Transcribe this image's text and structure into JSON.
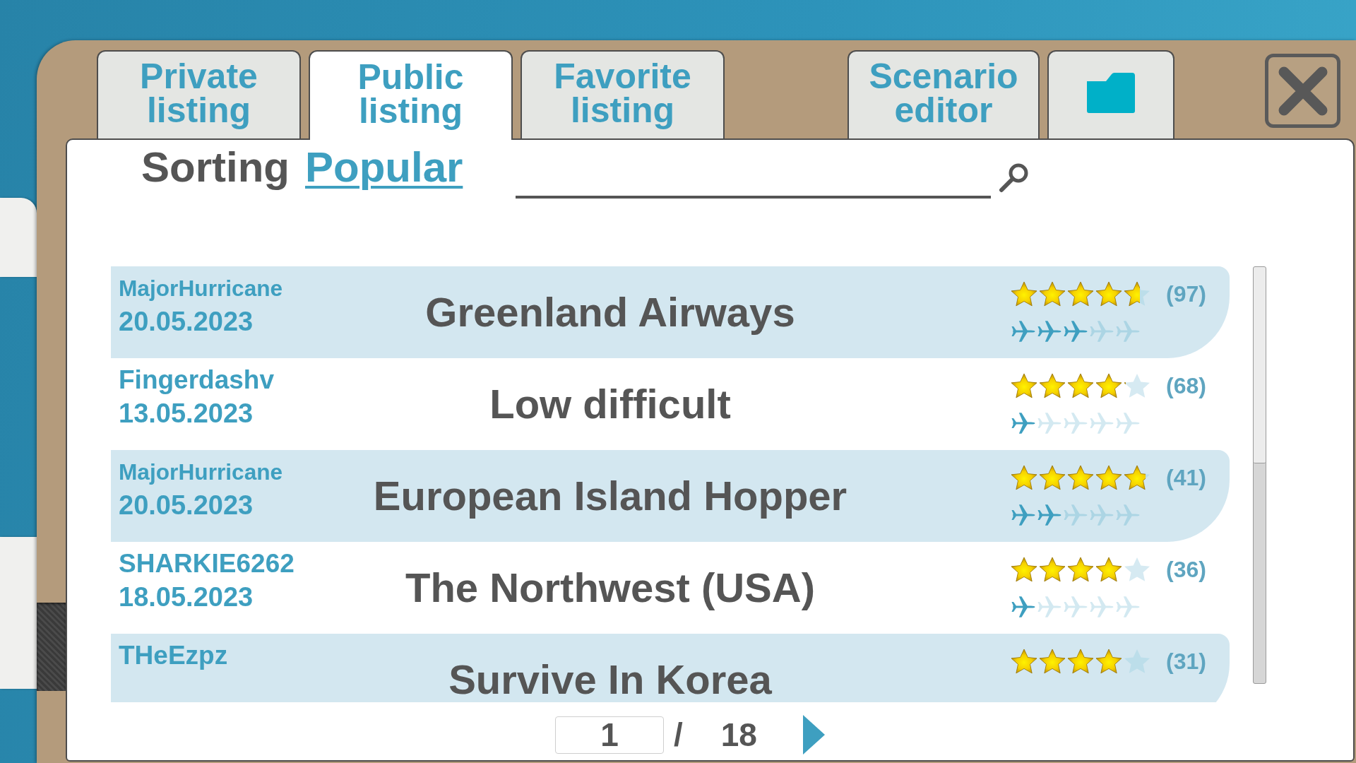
{
  "tabs": [
    {
      "label": "Private listing",
      "selected": false
    },
    {
      "label": "Public listing",
      "selected": true
    },
    {
      "label": "Favorite listing",
      "selected": false
    }
  ],
  "tool_tabs": [
    {
      "kind": "text",
      "label": "Scenario editor",
      "selected": false
    },
    {
      "kind": "icon",
      "selected": false
    }
  ],
  "sorting": {
    "label": "Sorting",
    "value": "Popular"
  },
  "scenarios": [
    {
      "author": "MajorHurricane",
      "date": "20.05.2023",
      "title": "Greenland Airways",
      "rating": {
        "stars": 4.6,
        "count": "(97)"
      },
      "difficulty": {
        "stars": 3
      }
    },
    {
      "author": "Fingerdashv",
      "date": "13.05.2023",
      "title": "Low difficult",
      "rating": {
        "stars": 4.1,
        "count": "(68)"
      },
      "difficulty": {
        "stars": 1
      }
    },
    {
      "author": "MajorHurricane",
      "date": "20.05.2023",
      "title": "European Island Hopper",
      "rating": {
        "stars": 4.8,
        "count": "(41)"
      },
      "difficulty": {
        "stars": 2
      }
    },
    {
      "author": "SHARKIE6262",
      "date": "18.05.2023",
      "title": "The Northwest (USA)",
      "rating": {
        "stars": 4,
        "count": "(36)"
      },
      "difficulty": {
        "stars": 1
      }
    },
    {
      "author": "THeEzpz",
      "title": "Survive In Korea",
      "rating": {
        "stars": 4,
        "count": "(31)"
      }
    }
  ],
  "pagination": {
    "page": "1",
    "separator": "/",
    "total": "18"
  }
}
